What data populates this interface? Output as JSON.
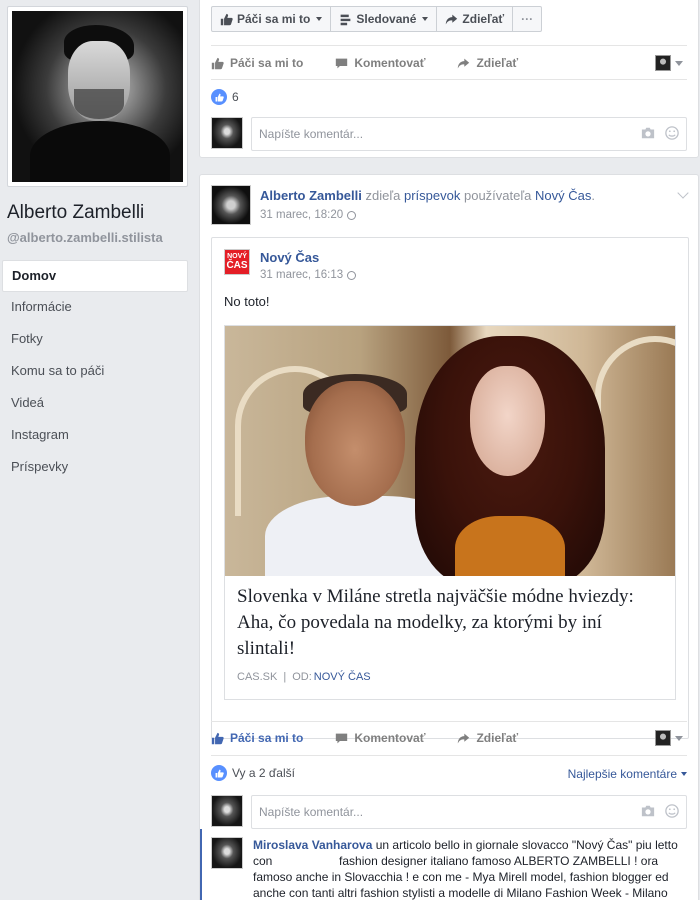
{
  "profile": {
    "name": "Alberto Zambelli",
    "handle": "@alberto.zambelli.stilista"
  },
  "nav": {
    "items": [
      {
        "label": "Domov"
      },
      {
        "label": "Informácie"
      },
      {
        "label": "Fotky"
      },
      {
        "label": "Komu sa to páči"
      },
      {
        "label": "Videá"
      },
      {
        "label": "Instagram"
      },
      {
        "label": "Príspevky"
      }
    ]
  },
  "page_actions": {
    "like": "Páči sa mi to",
    "follow": "Sledované",
    "share": "Zdieľať",
    "more": "···"
  },
  "post1": {
    "actions": {
      "like": "Páči sa mi to",
      "comment": "Komentovať",
      "share": "Zdieľať"
    },
    "like_count": "6",
    "comment_placeholder": "Napíšte komentár..."
  },
  "post2": {
    "author": "Alberto Zambelli",
    "shared_verb": "zdieľa",
    "shared_obj": "príspevok",
    "shared_of": "používateľa",
    "shared_page": "Nový Čas",
    "time": "31 marec, 18:20",
    "shared": {
      "page": "Nový Čas",
      "logo_top": "NOVÝ",
      "logo_bottom": "ČAS",
      "time": "31 marec, 16:13",
      "text": "No toto!",
      "link_title": "Slovenka v Miláne stretla najväčšie módne hviezdy: Aha, čo povedala na modelky, za ktorými by iní slintali!",
      "link_domain": "CAS.SK",
      "link_sep": "|",
      "link_by": "OD:",
      "link_by_page": "NOVÝ ČAS"
    },
    "actions": {
      "like": "Páči sa mi to",
      "comment": "Komentovať",
      "share": "Zdieľať"
    },
    "reactions_text": "Vy a 2 ďalší",
    "sort_label": "Najlepšie komentáre",
    "comment_placeholder": "Napíšte komentár...",
    "comment": {
      "author": "Miroslava Vanharova",
      "text_part1": "un articolo bello in giornale slovacco \"Nový Čas\" piu letto con",
      "text_part2": "fashion designer italiano famoso ALBERTO ZAMBELLI ! ora famoso anche in Slovacchia ! e con me - Mya Mirell model, fashion blogger ed anche con tanti altri fashion stylisti a modelle di Milano Fashion Week - Milano"
    }
  },
  "colors": {
    "link": "#365899",
    "liked": "#4267b2",
    "background": "#e9ebee"
  }
}
